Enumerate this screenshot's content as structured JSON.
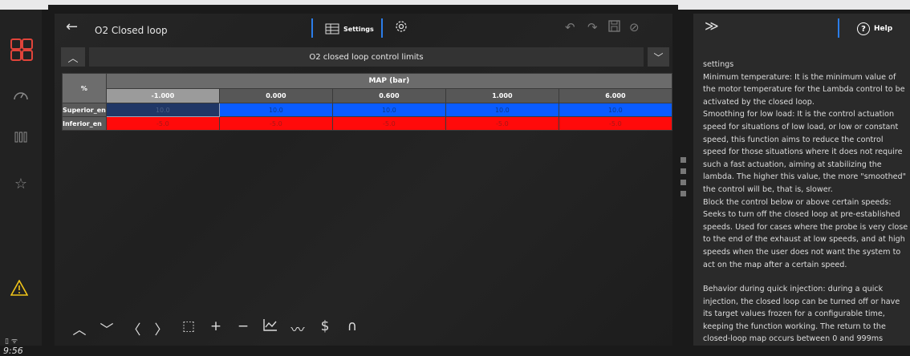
{
  "window": {
    "title": "O2 Closed loop"
  },
  "toolbar": {
    "settings_label": "Settings",
    "help_label": "Help"
  },
  "section": {
    "title": "O2 closed loop control limits"
  },
  "table": {
    "corner": "%",
    "map_header": "MAP (bar)",
    "columns": [
      "-1.000",
      "0.000",
      "0.600",
      "1.000",
      "6.000"
    ],
    "rows": [
      {
        "label": "Superior_en",
        "values": [
          "10.0",
          "10.0",
          "10.0",
          "10.0",
          "10.0"
        ]
      },
      {
        "label": "Inferior_en",
        "values": [
          "-5.0",
          "-5.0",
          "-5.0",
          "-5.0",
          "-5.0"
        ]
      }
    ]
  },
  "status": {
    "time": "9:56"
  },
  "help": {
    "paragraphs": [
      "settings",
      "Minimum temperature: It is the minimum value of the motor temperature for the Lambda control to be activated by the closed loop.",
      "Smoothing for low load: It is the control actuation speed for situations of low load, or low or constant speed, this function aims to reduce the control speed for those situations where it does not require such a fast actuation, aiming at stabilizing the lambda. The higher this value, the more \"smoothed\" the control will be, that is, slower.",
      "Block the control below or above certain speeds: Seeks to turn off the closed loop at pre-established speeds. Used for cases where the probe is very close to the end of the exhaust at low speeds, and at high speeds when the user does not want the system to act on the map after a certain speed.",
      "",
      "Behavior during quick injection: during a quick injection, the closed loop can be turned off or have its target values frozen for a configurable time, keeping the function working. The return to the closed-loop map occurs between 0 and 999ms"
    ]
  },
  "icons": {
    "apps": "apps-grid-icon",
    "gauge": "dashboard-icon",
    "bars": "columns-icon",
    "star": "star-icon",
    "warning": "warning-icon"
  },
  "colors": {
    "accent": "#2b7de9",
    "row_superior": "#0a5cff",
    "row_inferior": "#ff0a0a",
    "warning": "#f0c419",
    "apps": "#e0443a"
  }
}
